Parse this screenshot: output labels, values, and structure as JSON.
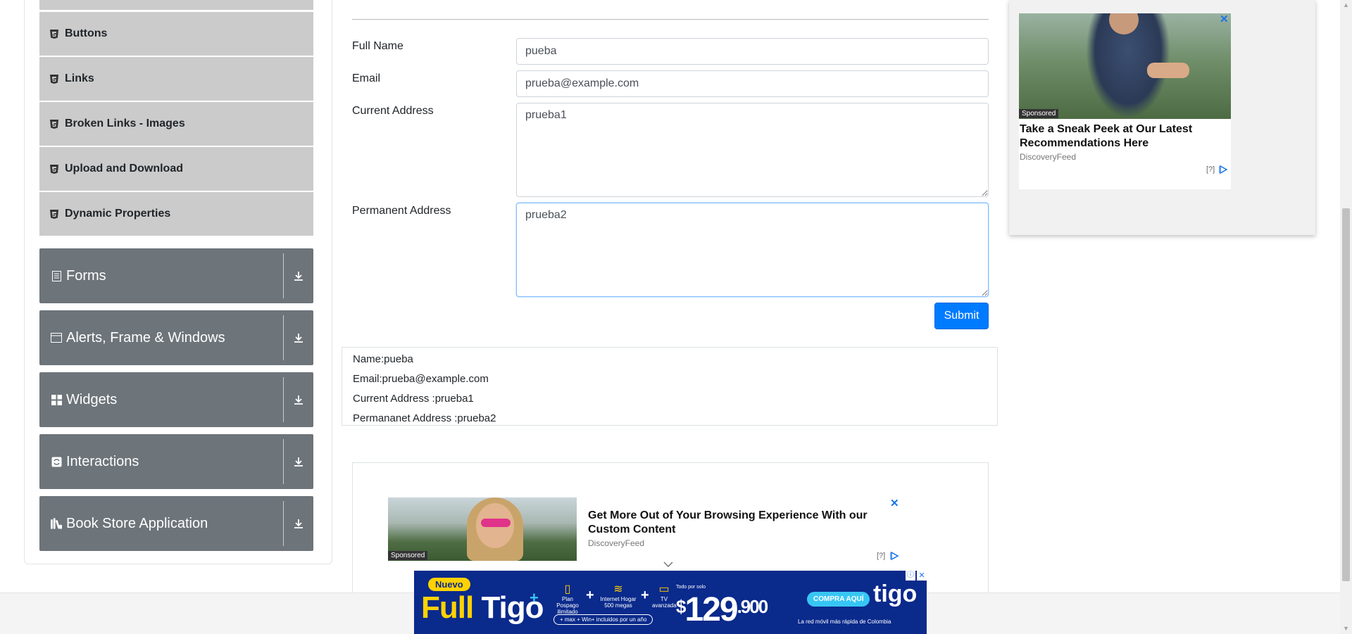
{
  "sidebar": {
    "sub_items": [
      {
        "label": "Buttons"
      },
      {
        "label": "Links"
      },
      {
        "label": "Broken Links - Images"
      },
      {
        "label": "Upload and Download"
      },
      {
        "label": "Dynamic Properties"
      }
    ],
    "groups": [
      {
        "label": "Forms",
        "icon": "form-icon"
      },
      {
        "label": "Alerts, Frame & Windows",
        "icon": "window-icon"
      },
      {
        "label": "Widgets",
        "icon": "grid-icon"
      },
      {
        "label": "Interactions",
        "icon": "interactions-icon"
      },
      {
        "label": "Book Store Application",
        "icon": "book-icon"
      }
    ]
  },
  "form": {
    "full_name": {
      "label": "Full Name",
      "value": "pueba"
    },
    "email": {
      "label": "Email",
      "value": "prueba@example.com"
    },
    "current_address": {
      "label": "Current Address",
      "value": "prueba1"
    },
    "permanent_address": {
      "label": "Permanent Address",
      "value": "prueba2"
    },
    "submit_label": "Submit"
  },
  "output": {
    "name": "Name:pueba",
    "email": "Email:prueba@example.com",
    "current_address": "Current Address :prueba1",
    "permanent_address": "Permananet Address :prueba2"
  },
  "ads": {
    "right": {
      "sponsored": "Sponsored",
      "title": "Take a Sneak Peek at Our Latest Recommendations Here",
      "source": "DiscoveryFeed",
      "info": "[?]",
      "close": "✕"
    },
    "bottom": {
      "sponsored": "Sponsored",
      "title": "Get More Out of Your Browsing Experience With our Custom Content",
      "source": "DiscoveryFeed",
      "info": "[?]",
      "close": "✕"
    },
    "tigo": {
      "badge": "Nuevo",
      "brand_full": "Full",
      "brand_tigo": "Tigo",
      "plus": "+",
      "feature1": "Plan Pospago ilimitado",
      "feature2": "Internet Hogar 500 megas",
      "feature3": "TV avanzada",
      "included": "+ max + Win+ incluidos por un año",
      "price_prefix": "Todo por solo",
      "currency": "$",
      "price_main": "129",
      "price_decimal": ".900",
      "cta": "COMPRA AQUÍ",
      "logo": "tigo",
      "tagline": "La red móvil más rápida de Colombia",
      "info": "ⓘ",
      "close": "✕"
    }
  },
  "colors": {
    "sub_item_bg": "#cbcbcb",
    "group_bg": "#6d747a",
    "submit_bg": "#007bff",
    "focus_border": "#80bdff",
    "tigo_bg": "#0a2a8c",
    "tigo_yellow": "#ffd200"
  }
}
